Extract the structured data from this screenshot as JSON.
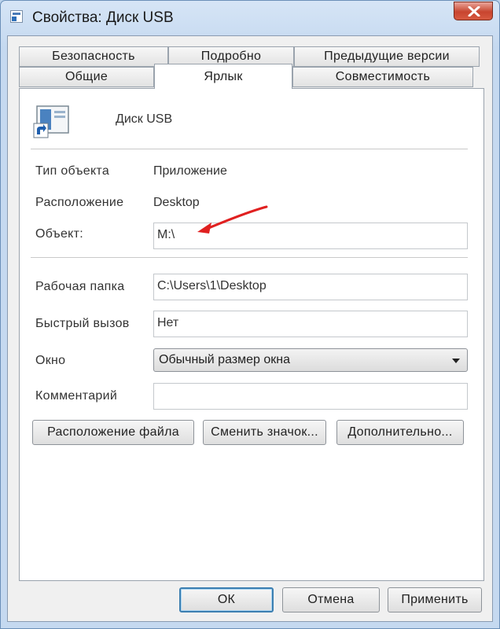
{
  "window": {
    "title": "Свойства: Диск USB",
    "icon": "shortcut-icon",
    "close_icon": "close-icon"
  },
  "tabs": {
    "row1": [
      "Безопасность",
      "Подробно",
      "Предыдущие версии"
    ],
    "row2": [
      "Общие",
      "Ярлык",
      "Совместимость"
    ],
    "active": "Ярлык"
  },
  "shortcut": {
    "name": "Диск USB"
  },
  "fields": {
    "type_label": "Тип объекта",
    "type_value": "Приложение",
    "location_label": "Расположение",
    "location_value": "Desktop",
    "target_label": "Объект:",
    "target_value": "M:\\",
    "workdir_label": "Рабочая папка",
    "workdir_value": "C:\\Users\\1\\Desktop",
    "hotkey_label": "Быстрый вызов",
    "hotkey_value": "Нет",
    "window_label": "Окно",
    "window_value": "Обычный размер окна",
    "comment_label": "Комментарий",
    "comment_value": ""
  },
  "buttons": {
    "file_location": "Расположение файла",
    "change_icon": "Сменить значок...",
    "advanced": "Дополнительно...",
    "ok": "ОК",
    "cancel": "Отмена",
    "apply": "Применить"
  },
  "colors": {
    "annotation_arrow": "#e02020",
    "default_button_border": "#3c7fb1"
  }
}
